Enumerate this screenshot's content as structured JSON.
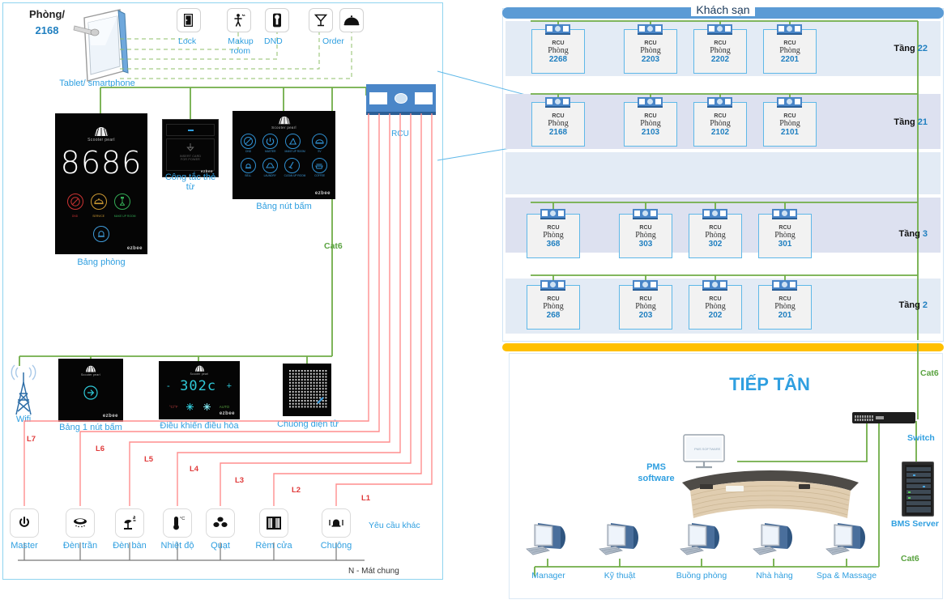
{
  "room_section": {
    "room_label": "Phòng/",
    "room_number": "2168",
    "tablet_caption": "Tablet/ smartphone",
    "service_buttons": [
      {
        "name": "door-icon",
        "label": "Lock"
      },
      {
        "name": "makeup-room-icon",
        "label": "Makup room"
      },
      {
        "name": "dnd-icon",
        "label": "DND"
      },
      {
        "name": "cocktail-icon",
        "label": ""
      },
      {
        "name": "room-service-icon",
        "label": "Order"
      }
    ],
    "devices": {
      "room_panel": {
        "caption": "Bảng phòng",
        "brand": "Scooter pearl",
        "display_number": "8686",
        "logo": "shell-logo",
        "vendor": "ezbee",
        "status_icons": [
          {
            "name": "dnd-icon",
            "label": "DND",
            "color": "#cc3333"
          },
          {
            "name": "service-icon",
            "label": "SERVICE",
            "color": "#cc9933"
          },
          {
            "name": "makeup-room-icon",
            "label": "MAKE UP ROOM",
            "color": "#33aa55"
          },
          {
            "name": "doorbell-icon",
            "label": "BELL",
            "color": "#3f9ad8"
          }
        ]
      },
      "card_switch": {
        "caption": "Công tắc thẻ từ",
        "text_line1": "INSERT CARD",
        "text_line2": "FOR POWER",
        "vendor": "ezbee"
      },
      "button_panel": {
        "caption": "Bảng nút bấm",
        "brand": "Scooter pearl",
        "vendor": "ezbee",
        "buttons": [
          {
            "name": "dnd-icon",
            "label": "DND"
          },
          {
            "name": "master-power-icon",
            "label": "MASTER"
          },
          {
            "name": "makeup-room-icon",
            "label": "MAKE UP ROOM"
          },
          {
            "name": "service-icon",
            "label": "SV"
          },
          {
            "name": "bell-icon",
            "label": "BELL"
          },
          {
            "name": "laundry-icon",
            "label": "LAUNDRY"
          },
          {
            "name": "clean-icon",
            "label": "CLEAN UP ROOM"
          },
          {
            "name": "coffee-icon",
            "label": "COFFEE"
          }
        ]
      },
      "wifi": {
        "caption": "Wifi",
        "icon": "wifi-tower-icon"
      },
      "single_button_panel": {
        "caption": "Bảng 1 nút bấm",
        "brand": "Scooter pearl",
        "vendor": "ezbee"
      },
      "ac_controller": {
        "caption": "Điều khiển điều hòa",
        "brand": "Scooter pearl",
        "temperature": "302c",
        "minus": "-",
        "plus": "+",
        "modes": [
          "°C/°F",
          "HEAT",
          "COOL",
          "AUTO"
        ],
        "vendor": "ezbee"
      },
      "doorbell": {
        "caption": "Chuông điện tử"
      }
    },
    "rcu_module": {
      "label": "RCU"
    },
    "cat6_label": "Cat6",
    "load_lines": [
      "L7",
      "L6",
      "L5",
      "L4",
      "L3",
      "L2",
      "L1"
    ],
    "neutral_label": "N - Mát chung",
    "other_request_label": "Yêu cầu khác",
    "controls": [
      {
        "name": "master-power-icon",
        "label": "Master"
      },
      {
        "name": "ceiling-light-icon",
        "label": "Đèn trần"
      },
      {
        "name": "desk-lamp-icon",
        "label": "Đèn bàn"
      },
      {
        "name": "thermometer-icon",
        "label": "Nhiệt độ"
      },
      {
        "name": "fan-icon",
        "label": "Quạt"
      },
      {
        "name": "curtain-icon",
        "label": "Rèm cửa"
      },
      {
        "name": "doorbell-icon",
        "label": "Chuông"
      }
    ]
  },
  "hotel_section": {
    "title": "Khách sạn",
    "floors": [
      {
        "label": "Tầng",
        "number": "22",
        "rooms": [
          {
            "type": "RCU",
            "word": "Phòng",
            "number": "2268"
          },
          {
            "type": "RCU",
            "word": "Phòng",
            "number": "2203"
          },
          {
            "type": "RCU",
            "word": "Phòng",
            "number": "2202"
          },
          {
            "type": "RCU",
            "word": "Phòng",
            "number": "2201"
          }
        ]
      },
      {
        "label": "Tầng",
        "number": "21",
        "rooms": [
          {
            "type": "RCU",
            "word": "Phòng",
            "number": "2168"
          },
          {
            "type": "RCU",
            "word": "Phòng",
            "number": "2103"
          },
          {
            "type": "RCU",
            "word": "Phòng",
            "number": "2102"
          },
          {
            "type": "RCU",
            "word": "Phòng",
            "number": "2101"
          }
        ]
      },
      {
        "label": "Tầng",
        "number": "3",
        "rooms": [
          {
            "type": "RCU",
            "word": "Phòng",
            "number": "368"
          },
          {
            "type": "RCU",
            "word": "Phòng",
            "number": "303"
          },
          {
            "type": "RCU",
            "word": "Phòng",
            "number": "302"
          },
          {
            "type": "RCU",
            "word": "Phòng",
            "number": "301"
          }
        ]
      },
      {
        "label": "Tầng",
        "number": "2",
        "rooms": [
          {
            "type": "RCU",
            "word": "Phòng",
            "number": "268"
          },
          {
            "type": "RCU",
            "word": "Phòng",
            "number": "203"
          },
          {
            "type": "RCU",
            "word": "Phòng",
            "number": "202"
          },
          {
            "type": "RCU",
            "word": "Phòng",
            "number": "201"
          }
        ]
      }
    ]
  },
  "reception_section": {
    "title": "TIẾP TÂN",
    "pms_label": "PMS software",
    "switch_label": "Switch",
    "bms_label": "BMS Server",
    "cat6_top": "Cat6",
    "cat6_bottom": "Cat6",
    "workstations": [
      {
        "label": "Manager"
      },
      {
        "label": "Kỹ thuật"
      },
      {
        "label": "Buồng phòng"
      },
      {
        "label": "Nhà hàng"
      },
      {
        "label": "Spa & Massage"
      }
    ]
  },
  "colors": {
    "accent_blue": "#2f9fe0",
    "link_blue": "#1f7fc0",
    "bar_blue": "#5b9bd5",
    "green_cable": "#70ad47",
    "red_line": "#ff5a5a",
    "yellow_bar": "#ffc000"
  }
}
